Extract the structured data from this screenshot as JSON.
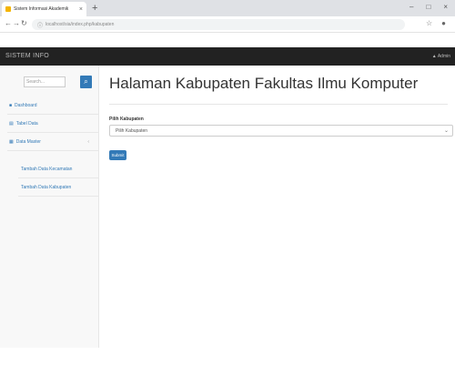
{
  "browser": {
    "tab_title": "Sistem Informasi Akademik",
    "tab_close": "×",
    "new_tab": "+",
    "url": "localhost/sia/index.php/kabupaten",
    "window_controls": [
      "–",
      "□",
      "×"
    ]
  },
  "navbar": {
    "brand": "SISTEM INFO",
    "user": "▲ Admin"
  },
  "sidebar": {
    "search_placeholder": "Search...",
    "search_icon": "search-icon",
    "items": [
      {
        "icon": "dashboard-icon",
        "label": "Dashboard"
      },
      {
        "icon": "table-icon",
        "label": "Tabel Data"
      },
      {
        "icon": "menu-icon",
        "label": "Data Master",
        "caret": "‹"
      }
    ],
    "sub_items": [
      {
        "label": "Tambah Data Kecamatan"
      },
      {
        "label": "Tambah Data Kabupaten"
      }
    ]
  },
  "main": {
    "title": "Halaman Kabupaten Fakultas Ilmu Komputer",
    "field_label": "Pilih Kabupaten",
    "select_value": "Pilih Kabupaten",
    "submit_label": "Submit"
  }
}
